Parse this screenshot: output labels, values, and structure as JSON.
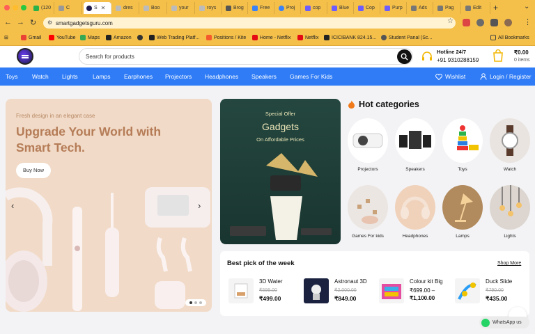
{
  "browser": {
    "tabs": [
      {
        "label": "(120",
        "color": "#2bb14a"
      },
      {
        "label": "C",
        "color": "#999999"
      },
      {
        "label": "S",
        "color": "#1d1a4e",
        "active": true
      },
      {
        "label": "dres",
        "color": "#999999"
      },
      {
        "label": "Boo",
        "color": "#999999"
      },
      {
        "label": "your",
        "color": "#999999"
      },
      {
        "label": "roys",
        "color": "#999999"
      },
      {
        "label": "Brog",
        "color": "#999999"
      },
      {
        "label": "Free",
        "color": "#3b82f6"
      },
      {
        "label": "Proj",
        "color": "#3b82f6"
      },
      {
        "label": "cop",
        "color": "#6d5dfc"
      },
      {
        "label": "Blue",
        "color": "#6d5dfc"
      },
      {
        "label": "Cop",
        "color": "#6d5dfc"
      },
      {
        "label": "Purp",
        "color": "#6d5dfc"
      },
      {
        "label": "Ads",
        "color": "#999999"
      },
      {
        "label": "Pag",
        "color": "#999999"
      },
      {
        "label": "Edit",
        "color": "#999999"
      }
    ],
    "url": "smartgadgetsguru.com",
    "bookmarks": [
      {
        "label": "Gmail",
        "color": "#ea4335"
      },
      {
        "label": "YouTube",
        "color": "#ff0000"
      },
      {
        "label": "Maps",
        "color": "#34a853"
      },
      {
        "label": "Amazon",
        "color": "#222222"
      },
      {
        "label": "",
        "color": "#333333"
      },
      {
        "label": "Web Trading Platf...",
        "color": "#222222"
      },
      {
        "label": "Positions / Kite",
        "color": "#f55a2c"
      },
      {
        "label": "Home - Netflix",
        "color": "#e50914"
      },
      {
        "label": "Netflix",
        "color": "#e50914"
      },
      {
        "label": "ICICIBANK 824.15...",
        "color": "#222222"
      },
      {
        "label": "Student Panal (Sc...",
        "color": "#555555"
      }
    ],
    "all_bookmarks": "All Bookmarks"
  },
  "header": {
    "search_placeholder": "Search for products",
    "hotline_label": "Hotline 24/7",
    "hotline_number": "+91 9310288159",
    "cart_total": "₹0.00",
    "cart_items": "0 items"
  },
  "nav": {
    "items": [
      "Toys",
      "Watch",
      "Lights",
      "Lamps",
      "Earphones",
      "Projectors",
      "Headphones",
      "Speakers",
      "Games For Kids"
    ],
    "wishlist": "Wishlist",
    "login": "Login / Register"
  },
  "hero": {
    "subtitle": "Fresh design in an elegant case",
    "title": "Upgrade Your World with Smart Tech.",
    "button": "Buy Now"
  },
  "offer": {
    "line1": "Special Offer",
    "line2": "Gadgets",
    "line3": "On Affordable Prices"
  },
  "hot_categories": {
    "title": "Hot categories",
    "items": [
      "Projectors",
      "Speakers",
      "Toys",
      "Watch",
      "Games For kids",
      "Headphones",
      "Lamps",
      "Lights"
    ]
  },
  "best_pick": {
    "title": "Best pick of the week",
    "shop_more": "Shop More",
    "products": [
      {
        "name": "3D Water",
        "old_price": "₹599.00",
        "price": "₹499.00"
      },
      {
        "name": "Astronaut 3D",
        "old_price": "₹2,000.00",
        "price": "₹849.00"
      },
      {
        "name": "Colour kit Big",
        "price_line1": "₹699.00 –",
        "price_line2": "₹1,100.00"
      },
      {
        "name": "Duck Slide",
        "old_price": "₹790.00",
        "price": "₹435.00"
      }
    ]
  },
  "whatsapp": "WhatsApp us"
}
